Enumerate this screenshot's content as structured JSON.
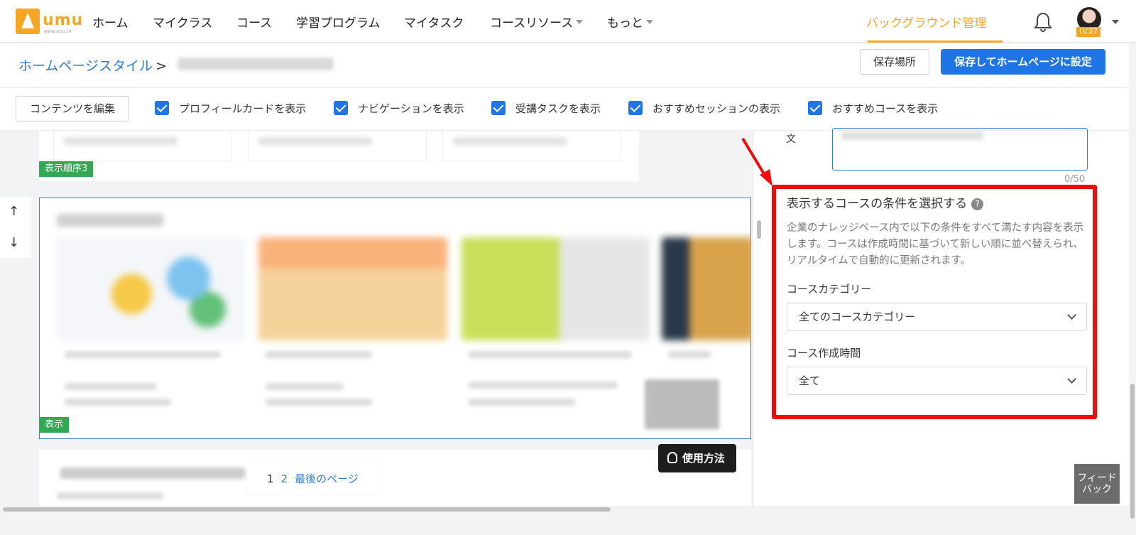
{
  "nav": {
    "logo_text": "umu",
    "logo_sub": "www.umu.co",
    "items": [
      "ホーム",
      "マイクラス",
      "コース",
      "学習プログラム",
      "マイタスク",
      "コースリソース",
      "もっと"
    ],
    "background_mgmt": "バックグラウンド管理",
    "user_level": "LV.27",
    "accent_color": "#f5a623"
  },
  "header": {
    "breadcrumb_root": "ホームページスタイル",
    "breadcrumb_sep": ">",
    "save_location_button": "保存場所",
    "save_home_button": "保存してホームページに設定"
  },
  "toolbar": {
    "edit_button": "コンテンツを編集",
    "checkboxes": [
      {
        "label": "プロフィールカードを表示",
        "checked": true
      },
      {
        "label": "ナビゲーションを表示",
        "checked": true
      },
      {
        "label": "受講タスクを表示",
        "checked": true
      },
      {
        "label": "おすすめセッションの表示",
        "checked": true
      },
      {
        "label": "おすすめコースを表示",
        "checked": true
      }
    ]
  },
  "canvas": {
    "order_tag_3": "表示順序3",
    "order_tag_4": "表示",
    "pager": {
      "current": "1",
      "next": "2",
      "last": "最後のページ"
    },
    "howto_button": "使用方法"
  },
  "panel": {
    "textarea_label": "文",
    "char_count": "0/50",
    "section_title": "表示するコースの条件を選択する",
    "help_icon": "?",
    "description": "企業のナレッジベース内で以下の条件をすべて満たす内容を表示します。コースは作成時間に基づいて新しい順に並べ替えられ、リアルタイムで自動的に更新されます。",
    "category_label": "コースカテゴリー",
    "category_value": "全てのコースカテゴリー",
    "time_label": "コース作成時間",
    "time_value": "全て"
  },
  "feedback": "フィードバック",
  "colors": {
    "primary": "#1f74e6",
    "highlight": "#f50a0a",
    "tag_green": "#33a852"
  }
}
